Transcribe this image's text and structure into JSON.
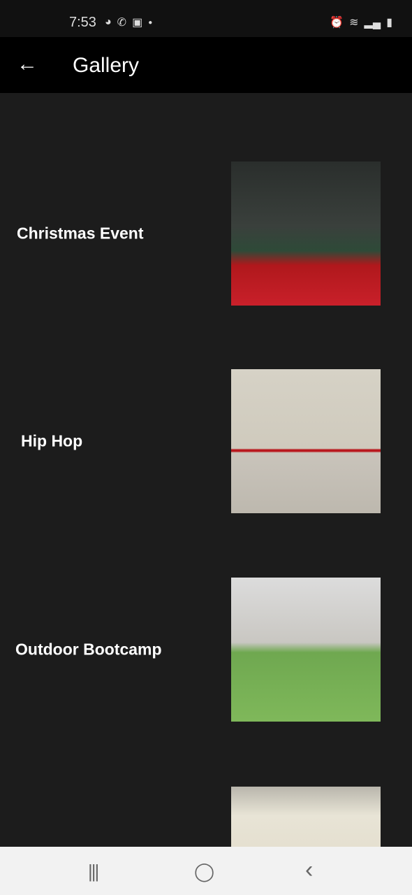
{
  "status_bar": {
    "time": "7:53"
  },
  "app_bar": {
    "title": "Gallery",
    "back_icon": "arrow-left-icon"
  },
  "gallery": [
    {
      "title": "Christmas Event"
    },
    {
      "title": "Hip Hop"
    },
    {
      "title": "Outdoor Bootcamp"
    },
    {
      "title": ""
    }
  ],
  "nav_bar": {
    "recents": "|||",
    "home": "◯",
    "back": "‹"
  }
}
